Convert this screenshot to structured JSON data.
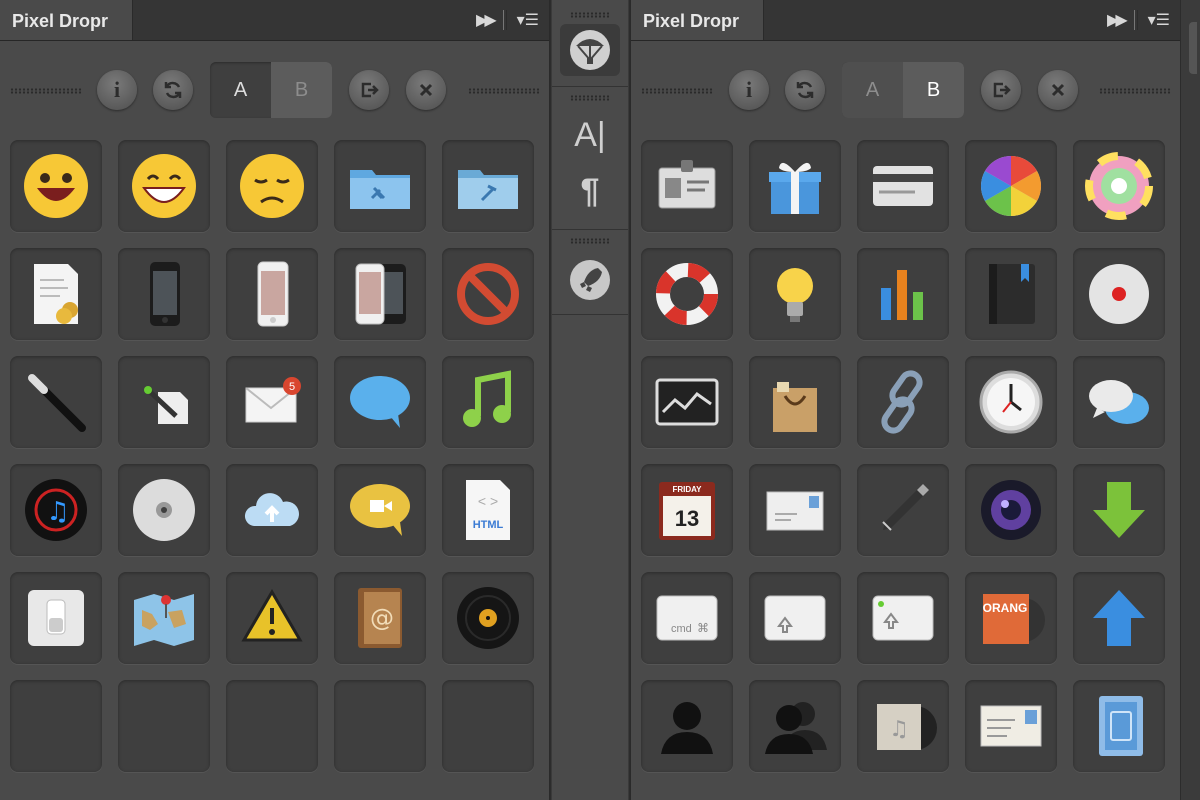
{
  "panel_a": {
    "title": "Pixel Dropr",
    "toolbar": {
      "info": "i",
      "refresh": "refresh",
      "seg_a": "A",
      "seg_b": "B",
      "export": "export",
      "close": "close"
    },
    "active_segment": "B",
    "icons": [
      "smiley-icon",
      "grin-icon",
      "sad-face-icon",
      "developer-folder-icon",
      "applications-folder-icon",
      "invoice-document-icon",
      "iphone-black-icon",
      "iphone-white-icon",
      "iphone-pair-icon",
      "no-entry-icon",
      "magic-wand-icon",
      "script-editor-icon",
      "mail-badge-icon",
      "speech-bubble-blue-icon",
      "music-note-icon",
      "itunes-disc-icon",
      "cd-rom-icon",
      "icloud-icon",
      "facetime-bubble-icon",
      "html-file-icon",
      "switch-icon",
      "maps-icon",
      "warning-icon",
      "address-book-icon",
      "vinyl-record-icon",
      "empty-slot",
      "empty-slot",
      "empty-slot",
      "empty-slot",
      "empty-slot"
    ],
    "mail_badge": "5",
    "html_label": "HTML"
  },
  "middle": {
    "text_tool": "A|",
    "paragraph_tool": "¶"
  },
  "panel_b": {
    "title": "Pixel Dropr",
    "toolbar": {
      "info": "i",
      "refresh": "refresh",
      "seg_a": "A",
      "seg_b": "B",
      "export": "export",
      "close": "close"
    },
    "active_segment": "B",
    "icons": [
      "id-badge-icon",
      "gift-icon",
      "credit-card-icon",
      "color-wheel-icon",
      "color-picker-icon",
      "life-ring-icon",
      "light-bulb-icon",
      "bar-chart-icon",
      "notebook-icon",
      "dvd-player-icon",
      "activity-monitor-icon",
      "shopping-bag-icon",
      "chain-link-icon",
      "clock-icon",
      "chat-bubbles-icon",
      "calendar-icon",
      "envelope-icon",
      "pen-icon",
      "camera-lens-icon",
      "down-arrow-icon",
      "cmd-key-icon",
      "shift-key-icon",
      "caps-lock-key-icon",
      "album-art-icon",
      "up-arrow-icon",
      "user-icon",
      "users-icon",
      "music-file-icon",
      "postcard-icon",
      "ipad-doc-icon"
    ],
    "calendar_day": "13",
    "calendar_label": "FRIDAY",
    "cmd_label": "cmd",
    "album_label": "ORANG"
  },
  "colors": {
    "panel_bg": "#4a4a4a",
    "cell_bg": "#3f3f3f",
    "tab_text": "#e8e8e8"
  }
}
